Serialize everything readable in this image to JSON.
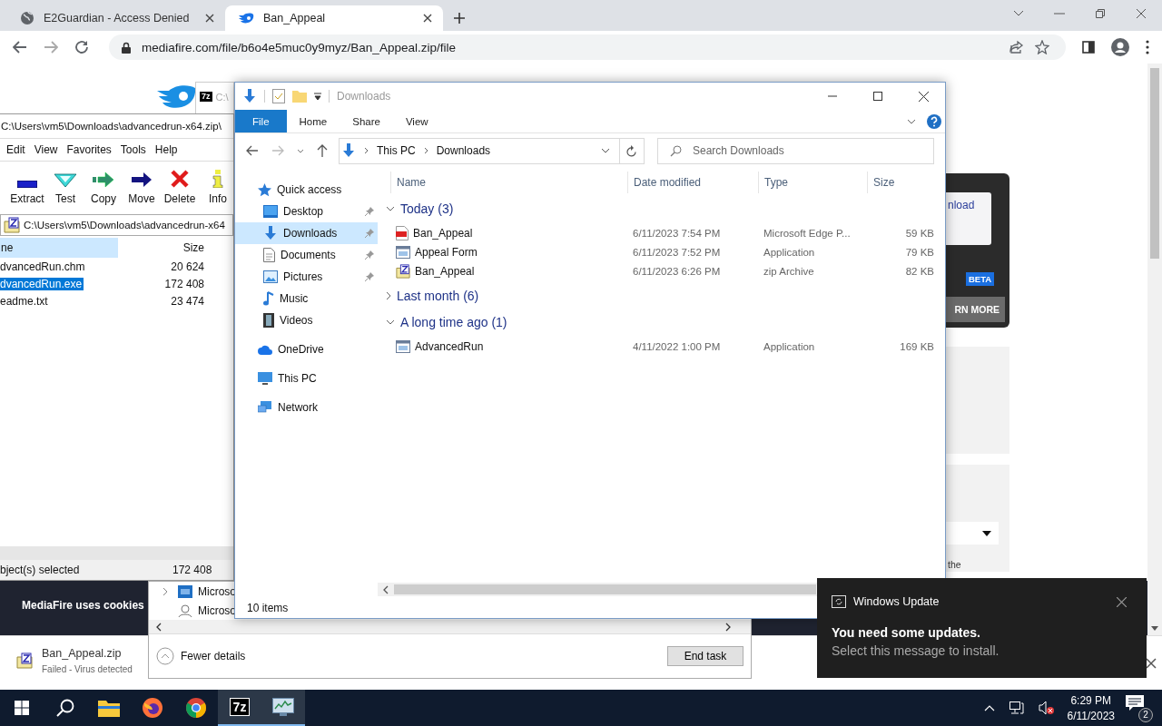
{
  "browser": {
    "tabs": [
      {
        "title": "E2Guardian - Access Denied",
        "kind": "globe",
        "selected": false
      },
      {
        "title": "Ban_Appeal",
        "kind": "mediafire",
        "selected": true
      }
    ],
    "url": "mediafire.com/file/b6o4e5muc0y9myz/Ban_Appeal.zip/file",
    "page": {
      "download_link": "nload",
      "badge": "BETA",
      "learn_more_button": "RN MORE",
      "text_fragment": "the",
      "cookie_banner": "MediaFire uses cookies"
    },
    "download_bar": {
      "file": "Ban_Appeal.zip",
      "status": "Failed - Virus detected"
    }
  },
  "background_window": {
    "logo": "7z",
    "path": "C:\\"
  },
  "sevenzip": {
    "title": "C:\\Users\\vm5\\Downloads\\advancedrun-x64.zip\\",
    "menu": [
      "Edit",
      "View",
      "Favorites",
      "Tools",
      "Help"
    ],
    "toolbar": [
      {
        "label": "Extract",
        "kind": "extract"
      },
      {
        "label": "Test",
        "kind": "test"
      },
      {
        "label": "Copy",
        "kind": "copy"
      },
      {
        "label": "Move",
        "kind": "move"
      },
      {
        "label": "Delete",
        "kind": "delete"
      },
      {
        "label": "Info",
        "kind": "info"
      }
    ],
    "address": "C:\\Users\\vm5\\Downloads\\advancedrun-x64",
    "columns": [
      "ne",
      "Size"
    ],
    "rows": [
      {
        "name": "dvancedRun.chm",
        "size": "20 624",
        "selected": false
      },
      {
        "name": "dvancedRun.exe",
        "size": "172 408",
        "selected": true
      },
      {
        "name": "eadme.txt",
        "size": "23 474",
        "selected": false
      }
    ],
    "status": {
      "text": "bject(s) selected",
      "size": "172 408"
    }
  },
  "explorer": {
    "title": "Downloads",
    "ribbon_tabs": [
      {
        "label": "File",
        "selected": true
      },
      {
        "label": "Home",
        "selected": false
      },
      {
        "label": "Share",
        "selected": false
      },
      {
        "label": "View",
        "selected": false
      }
    ],
    "breadcrumb": [
      "This PC",
      "Downloads"
    ],
    "search": {
      "placeholder": "Search Downloads"
    },
    "nav": [
      {
        "label": "Quick access",
        "kind": "star",
        "selected": false,
        "children": [
          {
            "label": "Desktop",
            "kind": "desktop",
            "pinned": true,
            "selected": false
          },
          {
            "label": "Downloads",
            "kind": "download",
            "pinned": true,
            "selected": true
          },
          {
            "label": "Documents",
            "kind": "documents",
            "pinned": true,
            "selected": false
          },
          {
            "label": "Pictures",
            "kind": "pictures",
            "pinned": true,
            "selected": false
          },
          {
            "label": "Music",
            "kind": "music",
            "pinned": false,
            "selected": false
          },
          {
            "label": "Videos",
            "kind": "videos",
            "pinned": false,
            "selected": false
          }
        ]
      },
      {
        "label": "OneDrive",
        "kind": "cloud",
        "selected": false
      },
      {
        "label": "This PC",
        "kind": "pc",
        "selected": false
      },
      {
        "label": "Network",
        "kind": "network",
        "selected": false
      }
    ],
    "columns": [
      "Name",
      "Date modified",
      "Type",
      "Size"
    ],
    "groups": [
      {
        "label": "Today (3)",
        "expanded": true,
        "files": [
          {
            "name": "Ban_Appeal",
            "date": "6/11/2023 7:54 PM",
            "type": "Microsoft Edge P...",
            "size": "59 KB",
            "kind": "pdf"
          },
          {
            "name": "Appeal Form",
            "date": "6/11/2023 7:52 PM",
            "type": "Application",
            "size": "79 KB",
            "kind": "app"
          },
          {
            "name": "Ban_Appeal",
            "date": "6/11/2023 6:26 PM",
            "type": "zip Archive",
            "size": "82 KB",
            "kind": "zip"
          }
        ]
      },
      {
        "label": "Last month (6)",
        "expanded": false
      },
      {
        "label": "A long time ago (1)",
        "expanded": true,
        "files": [
          {
            "name": "AdvancedRun",
            "date": "4/11/2022 1:00 PM",
            "type": "Application",
            "size": "169 KB",
            "kind": "app"
          }
        ]
      }
    ],
    "status": "10 items"
  },
  "task_manager": {
    "rows": [
      {
        "label": "Microso",
        "kind": "app",
        "expandable": true
      },
      {
        "label": "Microso",
        "kind": "user",
        "expandable": false
      }
    ],
    "details_toggle": "Fewer details",
    "end_task_button": "End task"
  },
  "toast": {
    "app": "Windows Update",
    "title": "You need some updates.",
    "body": "Select this message to install."
  },
  "taskbar": {
    "apps": [
      {
        "kind": "explorer",
        "active": false
      },
      {
        "kind": "firefox",
        "active": false
      },
      {
        "kind": "chrome",
        "active": false
      },
      {
        "kind": "sevenzip",
        "label": "7z",
        "active": true
      },
      {
        "kind": "taskmgr",
        "active": true
      }
    ],
    "time": "6:29 PM",
    "date": "6/11/2023",
    "notification_count": "2"
  }
}
